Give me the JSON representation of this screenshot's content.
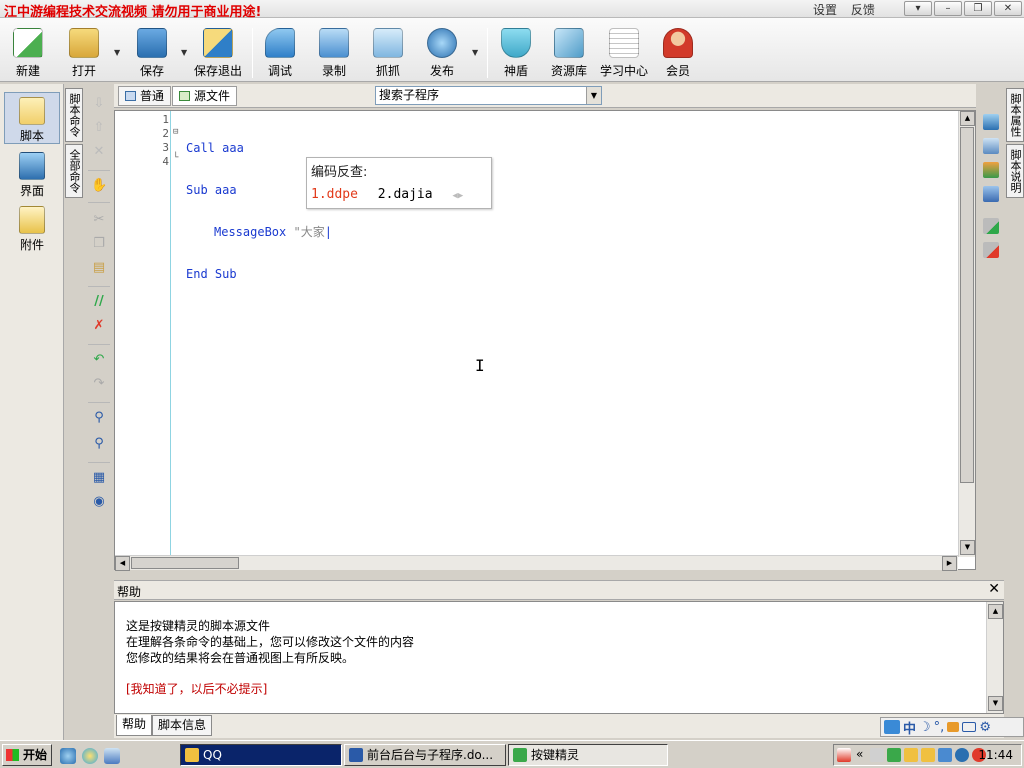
{
  "title_bar": {
    "title": "江中游编程技术交流视频  请勿用于商业用途!",
    "menu": [
      "设置",
      "反馈"
    ],
    "controls": [
      "chevron-down-icon",
      "minimize-icon",
      "restore-icon",
      "close-icon"
    ]
  },
  "toolbar": {
    "buttons": [
      {
        "label": "新建",
        "icon": "new-doc-icon",
        "color": "#4caf50"
      },
      {
        "label": "打开",
        "icon": "open-folder-icon",
        "color": "#e8c24a"
      },
      {
        "label": "保存",
        "icon": "save-icon",
        "color": "#2f7fc8"
      },
      {
        "label": "保存退出",
        "icon": "save-exit-icon",
        "color": "#e8c24a"
      },
      {
        "label": "调试",
        "icon": "debug-icon",
        "color": "#2f9d4a"
      },
      {
        "label": "录制",
        "icon": "record-camera-icon",
        "color": "#4a8fd0"
      },
      {
        "label": "抓抓",
        "icon": "grab-hand-icon",
        "color": "#7fb6e0"
      },
      {
        "label": "发布",
        "icon": "publish-globe-icon",
        "color": "#3a8ad6"
      },
      {
        "label": "神盾",
        "icon": "shield-icon",
        "color": "#3fa8c8"
      },
      {
        "label": "资源库",
        "icon": "resource-library-icon",
        "color": "#4f9cc8"
      },
      {
        "label": "学习中心",
        "icon": "learning-center-icon",
        "color": "#c6c6c6"
      },
      {
        "label": "会员",
        "icon": "member-icon",
        "color": "#d23a2a"
      }
    ]
  },
  "left_nav": {
    "items": [
      {
        "label": "脚本",
        "icon": "script-icon",
        "color": "#f1cf6a",
        "active": true
      },
      {
        "label": "界面",
        "icon": "interface-icon",
        "color": "#3e8bd0",
        "active": false
      },
      {
        "label": "附件",
        "icon": "attachment-icon",
        "color": "#e8c24a",
        "active": false
      }
    ],
    "vertical_tabs": [
      "脚本命令",
      "全部命令"
    ]
  },
  "tabs": {
    "items": [
      "普通",
      "源文件"
    ],
    "search_placeholder": "搜索子程序"
  },
  "editor": {
    "line_numbers": [
      "1",
      "2",
      "3",
      "4"
    ],
    "lines": [
      "Call aaa",
      "Sub aaa",
      "MessageBox ",
      "End Sub"
    ],
    "string_fragment": "\"大家"
  },
  "ime_popup": {
    "title": "编码反查:",
    "candidates": [
      "1.ddpe",
      "2.dajia"
    ]
  },
  "right_panel": {
    "tabs": [
      "脚本属性",
      "脚本说明"
    ]
  },
  "help": {
    "title": "帮助",
    "lines": [
      "这是按键精灵的脚本源文件",
      "在理解各条命令的基础上，您可以修改这个文件的内容",
      "您修改的结果将会在普通视图上有所反映。"
    ],
    "link": "[我知道了，以后不必提示]",
    "tabs": [
      "帮助",
      "脚本信息"
    ]
  },
  "ime_status": {
    "mode": "中",
    "moon": "☽"
  },
  "taskbar": {
    "start": "开始",
    "tasks": [
      "QQ",
      "前台后台与子程序.do...",
      "按键精灵"
    ],
    "clock": "11:44",
    "tray_expand": "«"
  }
}
